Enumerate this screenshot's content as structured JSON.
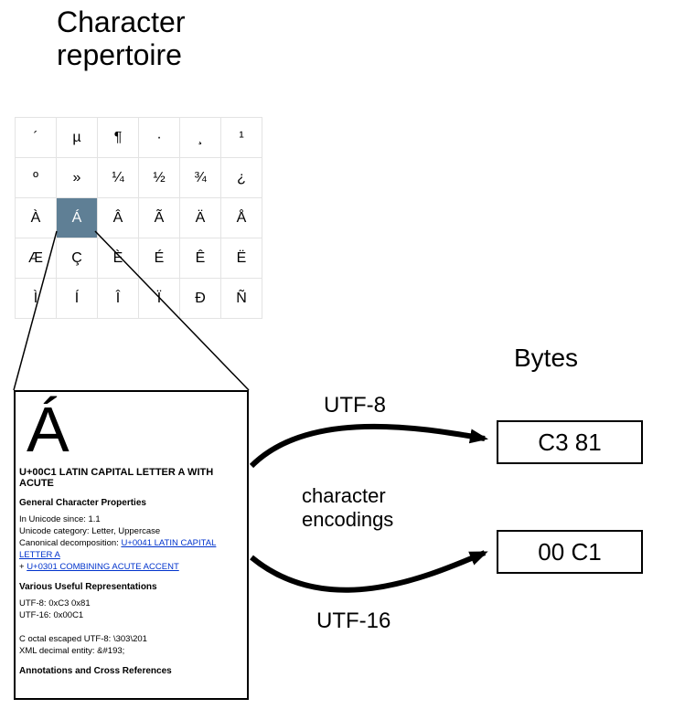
{
  "title_line1": "Character",
  "title_line2": "repertoire",
  "grid": [
    [
      "´",
      "µ",
      "¶",
      "·",
      "¸",
      "¹"
    ],
    [
      "º",
      "»",
      "¼",
      "½",
      "¾",
      "¿"
    ],
    [
      "À",
      "Á",
      "Â",
      "Ã",
      "Ä",
      "Å"
    ],
    [
      "Æ",
      "Ç",
      "È",
      "É",
      "Ê",
      "Ë"
    ],
    [
      "Ì",
      "Í",
      "Î",
      "Ï",
      "Ð",
      "Ñ"
    ]
  ],
  "selected_char_row": 2,
  "selected_char_col": 1,
  "detail": {
    "big_char": "Á",
    "codepoint_name": "U+00C1 LATIN CAPITAL LETTER A WITH ACUTE",
    "general_props_heading": "General Character Properties",
    "since": "In Unicode since: 1.1",
    "category": "Unicode category: Letter, Uppercase",
    "canonical_prefix": "Canonical decomposition: ",
    "decomp_link1": "U+0041 LATIN CAPITAL LETTER A",
    "decomp_plus": " + ",
    "decomp_link2": "U+0301 COMBINING ACUTE ACCENT",
    "useful_heading": "Various Useful Representations",
    "utf8_line": "UTF-8: 0xC3 0x81",
    "utf16_line": "UTF-16: 0x00C1",
    "octal_line": "C octal escaped UTF-8: \\303\\201",
    "xml_line": "XML decimal entity: &#193;",
    "annot_heading": "Annotations and Cross References"
  },
  "bytes_label": "Bytes",
  "utf8_label": "UTF-8",
  "utf16_label": "UTF-16",
  "encodings_line1": "character",
  "encodings_line2": "encodings",
  "bytes_utf8": "C3 81",
  "bytes_utf16": "00 C1"
}
